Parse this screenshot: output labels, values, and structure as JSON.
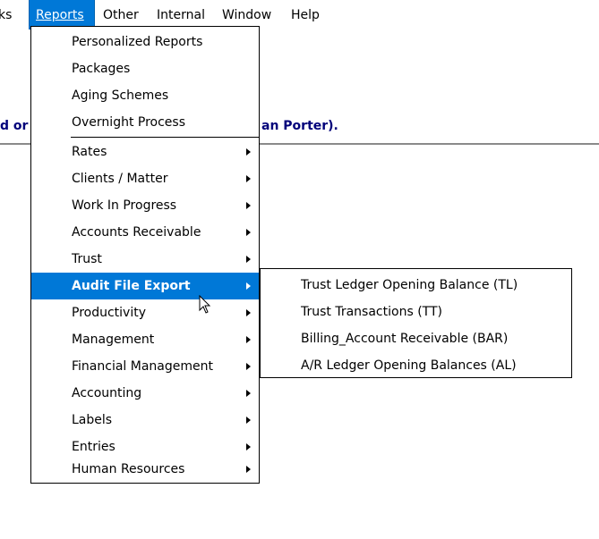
{
  "menubar": {
    "items": [
      {
        "label": "ks",
        "underline": ""
      },
      {
        "label": "Reports",
        "underline": "R"
      },
      {
        "label": "Other",
        "underline": "O"
      },
      {
        "label": "Internal",
        "underline": "I"
      },
      {
        "label": "Window",
        "underline": "W"
      },
      {
        "label": "Help",
        "underline": "H"
      }
    ],
    "active_index": 1
  },
  "banner": {
    "left_text": "d or",
    "right_text": "an Porter)."
  },
  "reports_menu": {
    "items": [
      {
        "label": "Personalized Reports",
        "has_submenu": false
      },
      {
        "label": "Packages",
        "has_submenu": false
      },
      {
        "label": "Aging Schemes",
        "has_submenu": false
      },
      {
        "label": "Overnight Process",
        "has_submenu": false
      },
      {
        "label": "Rates",
        "has_submenu": true
      },
      {
        "label": "Clients / Matter",
        "has_submenu": true
      },
      {
        "label": "Work In Progress",
        "has_submenu": true
      },
      {
        "label": "Accounts Receivable",
        "has_submenu": true
      },
      {
        "label": "Trust",
        "has_submenu": true
      },
      {
        "label": "Audit File Export",
        "has_submenu": true,
        "highlighted": true
      },
      {
        "label": "Productivity",
        "has_submenu": true
      },
      {
        "label": "Management",
        "has_submenu": true
      },
      {
        "label": "Financial Management",
        "has_submenu": true
      },
      {
        "label": "Accounting",
        "has_submenu": true
      },
      {
        "label": "Labels",
        "has_submenu": true
      },
      {
        "label": "Entries",
        "has_submenu": true
      },
      {
        "label": "Human Resources",
        "has_submenu": true
      }
    ]
  },
  "audit_submenu": {
    "items": [
      {
        "label": "Trust Ledger Opening Balance (TL)"
      },
      {
        "label": "Trust Transactions (TT)"
      },
      {
        "label": "Billing_Account Receivable (BAR)"
      },
      {
        "label": "A/R Ledger Opening Balances (AL)"
      }
    ]
  },
  "colors": {
    "highlight": "#0078d7",
    "banner_text": "#00007a"
  }
}
